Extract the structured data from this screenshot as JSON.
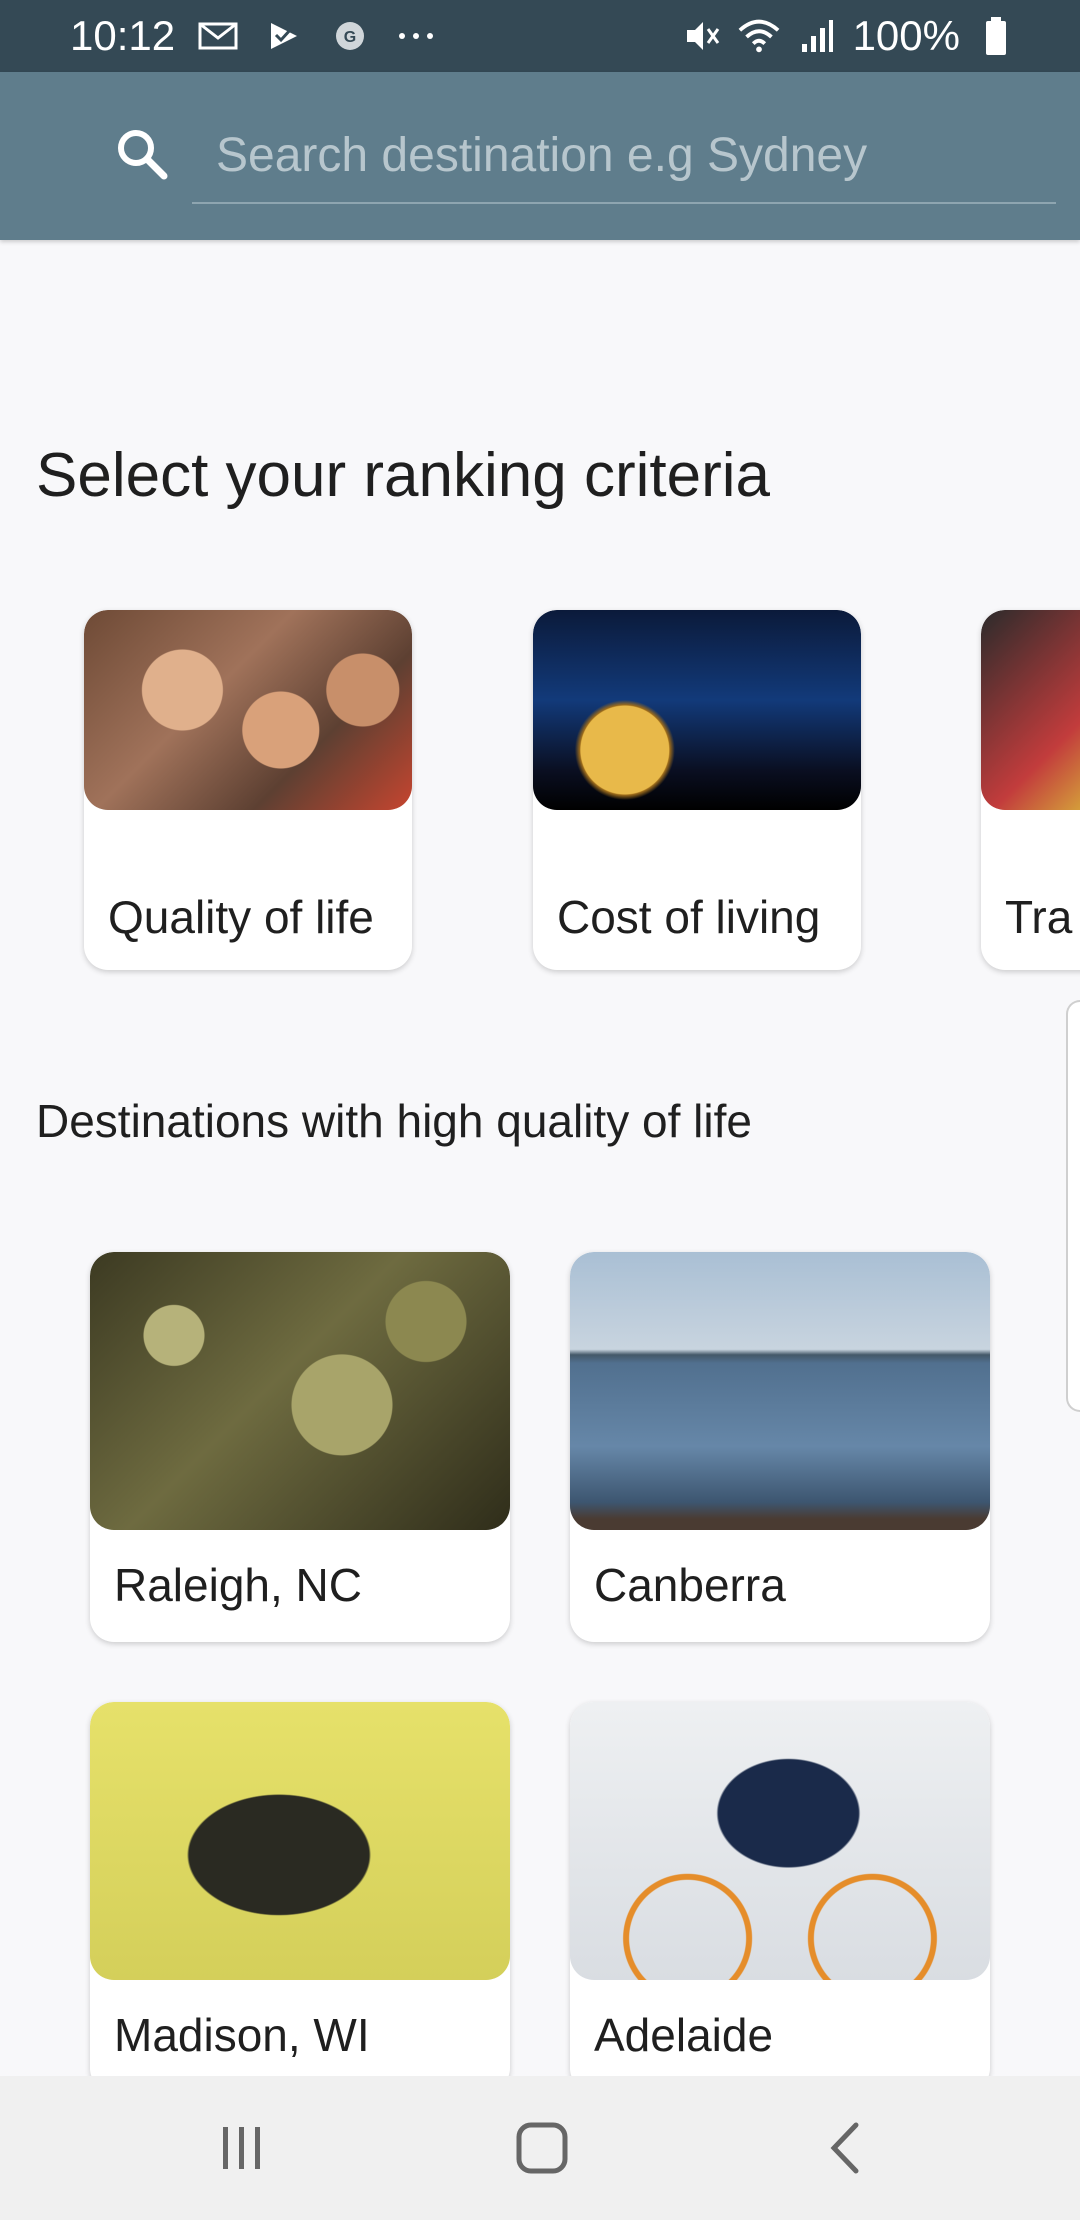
{
  "status_bar": {
    "time": "10:12",
    "battery": "100%",
    "left_icons": [
      "gmail-icon",
      "check-icon",
      "g-icon",
      "more-icon"
    ],
    "right_icons": [
      "mute-icon",
      "wifi-icon",
      "signal-icon",
      "battery-icon"
    ]
  },
  "search": {
    "placeholder": "Search destination e.g Sydney"
  },
  "criteria": {
    "title": "Select your ranking criteria",
    "items": [
      {
        "label": "Quality of life"
      },
      {
        "label": "Cost of living"
      },
      {
        "label": "Tra"
      }
    ]
  },
  "destinations": {
    "title": "Destinations with high quality of life",
    "items": [
      {
        "label": "Raleigh, NC"
      },
      {
        "label": "Canberra"
      },
      {
        "label": "Madison, WI"
      },
      {
        "label": "Adelaide"
      }
    ]
  },
  "colors": {
    "status_bar": "#344955",
    "app_bar": "#5f7d8c",
    "background": "#f8f8fa"
  },
  "nav": {
    "items": [
      "recents-icon",
      "home-icon",
      "back-icon"
    ]
  }
}
